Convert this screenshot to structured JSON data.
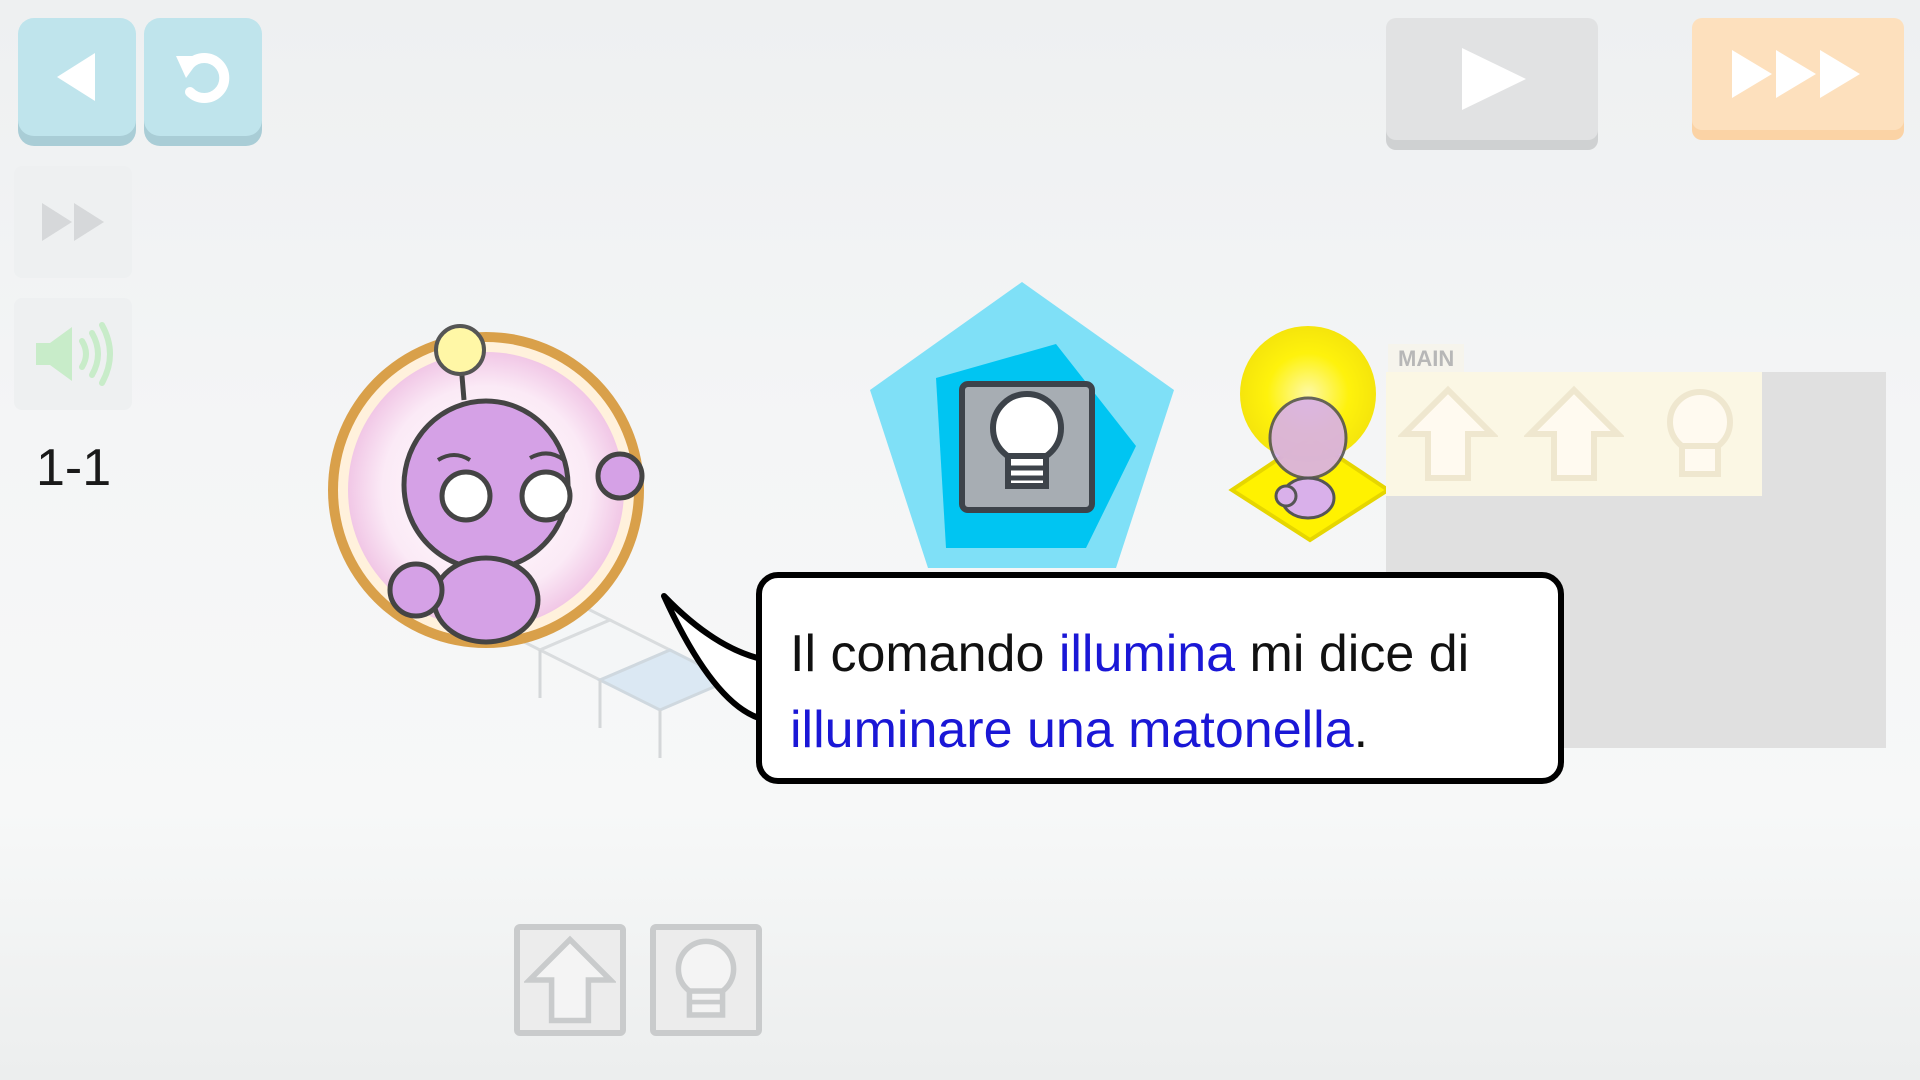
{
  "level": {
    "label": "1-1"
  },
  "toolbar": {
    "back_icon": "back-arrow-icon",
    "reset_icon": "undo-icon",
    "speed_icon": "fast-forward-icon",
    "sound_icon": "speaker-icon",
    "play_icon": "play-icon",
    "fast_play_icon": "triple-play-icon"
  },
  "dialog": {
    "part1": "Il comando ",
    "hl1": "illumina",
    "part2": " mi dice di",
    "hl2": "illuminare una matonella",
    "part3": "."
  },
  "program": {
    "main_label": "MAIN",
    "commands": [
      "up-arrow-icon",
      "up-arrow-icon",
      "lightbulb-icon"
    ]
  },
  "palette": {
    "commands": [
      "up-arrow-icon",
      "lightbulb-icon"
    ]
  },
  "colors": {
    "accent_cyan": "#bfe4ec",
    "play_orange": "#fde0bd",
    "highlight_text": "#1a17d6",
    "tile_yellow": "#fff200",
    "robot_purple": "#d9a6e9"
  }
}
